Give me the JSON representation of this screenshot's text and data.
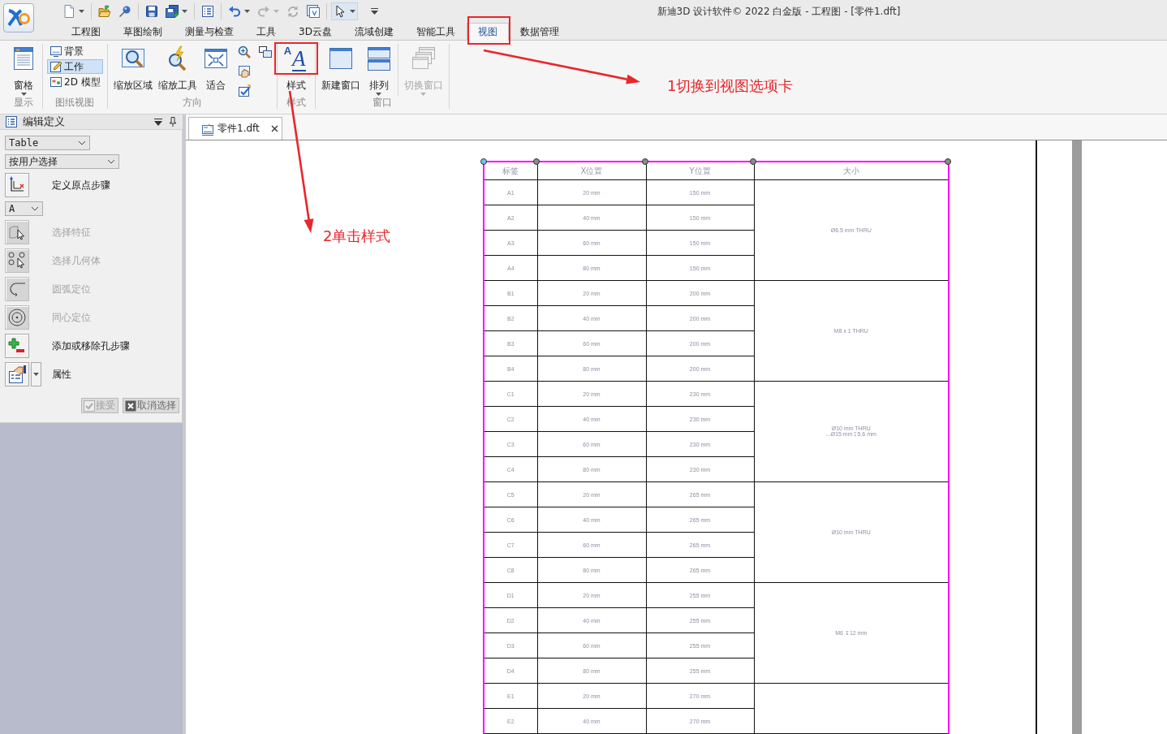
{
  "app": {
    "title": "新迪3D 设计软件© 2022 白金版 - 工程图 - [零件1.dft]"
  },
  "quick_access": [
    {
      "kind": "button",
      "dropdown": true,
      "disabled": false,
      "selected": false
    },
    {
      "kind": "separator"
    },
    {
      "kind": "button",
      "dropdown": false,
      "disabled": false,
      "selected": false
    },
    {
      "kind": "button",
      "dropdown": false,
      "disabled": false,
      "selected": false
    },
    {
      "kind": "separator"
    },
    {
      "kind": "button",
      "dropdown": false,
      "disabled": false,
      "selected": false
    },
    {
      "kind": "button",
      "dropdown": true,
      "disabled": false,
      "selected": false
    },
    {
      "kind": "separator"
    },
    {
      "kind": "button",
      "dropdown": false,
      "disabled": false,
      "selected": false
    },
    {
      "kind": "separator"
    },
    {
      "kind": "button",
      "dropdown": true,
      "disabled": false,
      "selected": false
    },
    {
      "kind": "button",
      "dropdown": true,
      "disabled": true,
      "selected": false
    },
    {
      "kind": "button",
      "dropdown": false,
      "disabled": true,
      "selected": false
    },
    {
      "kind": "button",
      "dropdown": false,
      "disabled": false,
      "selected": false
    },
    {
      "kind": "separator"
    },
    {
      "kind": "button",
      "dropdown": true,
      "disabled": false,
      "selected": true
    },
    {
      "kind": "menu"
    }
  ],
  "tabs": [
    {
      "label": "工程图",
      "selected": false,
      "highlighted": false
    },
    {
      "label": "草图绘制",
      "selected": false,
      "highlighted": false
    },
    {
      "label": "测量与检查",
      "selected": false,
      "highlighted": false
    },
    {
      "label": "工具",
      "selected": false,
      "highlighted": false
    },
    {
      "label": "3D云盘",
      "selected": false,
      "highlighted": false
    },
    {
      "label": "流域创建",
      "selected": false,
      "highlighted": false
    },
    {
      "label": "智能工具",
      "selected": false,
      "highlighted": false
    },
    {
      "label": "视图",
      "selected": true,
      "highlighted": true
    },
    {
      "label": "数据管理",
      "selected": false,
      "highlighted": false
    }
  ],
  "ribbon": {
    "groups": [
      {
        "label": "显示",
        "items": [
          {
            "kind": "large",
            "label": "窗格",
            "dropdown": true,
            "disabled": false,
            "highlighted": false
          }
        ]
      },
      {
        "label": "图纸视图",
        "items": [
          {
            "kind": "small",
            "label": "背景",
            "selected": false
          },
          {
            "kind": "small",
            "label": "工作",
            "selected": true
          },
          {
            "kind": "small",
            "label": "2D 模型",
            "selected": false
          }
        ]
      },
      {
        "label": "方向",
        "items": [
          {
            "kind": "large",
            "label": "缩放区域",
            "dropdown": false,
            "disabled": false,
            "highlighted": false
          },
          {
            "kind": "large",
            "label": "缩放工具",
            "dropdown": false,
            "disabled": false,
            "highlighted": false
          },
          {
            "kind": "large",
            "label": "适合",
            "dropdown": false,
            "disabled": false,
            "highlighted": false
          },
          {
            "kind": "icon"
          },
          {
            "kind": "icon"
          },
          {
            "kind": "icon"
          },
          {
            "kind": "icon"
          }
        ]
      },
      {
        "label": "样式",
        "items": [
          {
            "kind": "large",
            "label": "样式",
            "icon_glyphs": [
              "A",
              "A"
            ],
            "dropdown": false,
            "disabled": false,
            "highlighted": true
          }
        ]
      },
      {
        "label": "窗口",
        "items": [
          {
            "kind": "large",
            "label": "新建窗口",
            "dropdown": false,
            "disabled": false,
            "highlighted": false
          },
          {
            "kind": "large",
            "label": "排列",
            "dropdown": true,
            "disabled": false,
            "highlighted": false
          },
          {
            "kind": "separator"
          },
          {
            "kind": "large",
            "label": "切换窗口",
            "dropdown": true,
            "disabled": true,
            "highlighted": false
          }
        ]
      }
    ]
  },
  "panel": {
    "title": "编辑定义",
    "controls": [
      {
        "kind": "select",
        "value": "Table"
      },
      {
        "kind": "select",
        "value": "按用户选择"
      },
      {
        "kind": "step",
        "label": "定义原点步骤",
        "disabled": false
      },
      {
        "kind": "select",
        "value": "A"
      },
      {
        "kind": "step",
        "label": "选择特征",
        "disabled": true
      },
      {
        "kind": "step",
        "label": "选择几何体",
        "disabled": true
      },
      {
        "kind": "step",
        "label": "圆弧定位",
        "disabled": true
      },
      {
        "kind": "step",
        "label": "同心定位",
        "disabled": true
      },
      {
        "kind": "step",
        "label": "添加或移除孔步骤",
        "disabled": false
      },
      {
        "kind": "step",
        "label": "属性",
        "disabled": false,
        "dropdown": true
      }
    ],
    "actions": [
      {
        "label": "接受",
        "disabled": true
      },
      {
        "label": "取消选择",
        "disabled": false
      }
    ]
  },
  "document": {
    "tabs": [
      {
        "label": "零件1.dft",
        "selected": true
      }
    ],
    "table": {
      "handles": [
        {
          "selected": true
        },
        {
          "selected": false
        },
        {
          "selected": false
        },
        {
          "selected": false
        },
        {
          "selected": false
        }
      ],
      "columns": [
        "标签",
        "X位置",
        "Y位置",
        "大小"
      ],
      "groups": [
        {
          "size": [
            "Ø6.5 mm THRU"
          ],
          "rows": [
            {
              "label": "A1",
              "x": "20 mm",
              "y": "150 mm"
            },
            {
              "label": "A2",
              "x": "40 mm",
              "y": "150 mm"
            },
            {
              "label": "A3",
              "x": "60 mm",
              "y": "150 mm"
            },
            {
              "label": "A4",
              "x": "80 mm",
              "y": "150 mm"
            }
          ]
        },
        {
          "size": [
            "M8 x 1 THRU"
          ],
          "rows": [
            {
              "label": "B1",
              "x": "20 mm",
              "y": "200 mm"
            },
            {
              "label": "B2",
              "x": "40 mm",
              "y": "200 mm"
            },
            {
              "label": "B3",
              "x": "60 mm",
              "y": "200 mm"
            },
            {
              "label": "B4",
              "x": "80 mm",
              "y": "200 mm"
            }
          ]
        },
        {
          "size": [
            "Ø10 mm THRU",
            "⌴Ø15 mm ↧5.6 mm"
          ],
          "rows": [
            {
              "label": "C1",
              "x": "20 mm",
              "y": "230 mm"
            },
            {
              "label": "C2",
              "x": "40 mm",
              "y": "230 mm"
            },
            {
              "label": "C3",
              "x": "60 mm",
              "y": "230 mm"
            },
            {
              "label": "C4",
              "x": "80 mm",
              "y": "230 mm"
            }
          ]
        },
        {
          "size": [
            "Ø10 mm THRU"
          ],
          "rows": [
            {
              "label": "C5",
              "x": "20 mm",
              "y": "265 mm"
            },
            {
              "label": "C6",
              "x": "40 mm",
              "y": "265 mm"
            },
            {
              "label": "C7",
              "x": "60 mm",
              "y": "265 mm"
            },
            {
              "label": "C8",
              "x": "80 mm",
              "y": "265 mm"
            }
          ]
        },
        {
          "size": [
            "M6 ↧12 mm"
          ],
          "rows": [
            {
              "label": "D1",
              "x": "20 mm",
              "y": "255 mm"
            },
            {
              "label": "D2",
              "x": "40 mm",
              "y": "255 mm"
            },
            {
              "label": "D3",
              "x": "60 mm",
              "y": "255 mm"
            },
            {
              "label": "D4",
              "x": "80 mm",
              "y": "255 mm"
            }
          ]
        },
        {
          "rows": [
            {
              "label": "E1",
              "x": "20 mm",
              "y": "270 mm"
            },
            {
              "label": "E2",
              "x": "40 mm",
              "y": "270 mm"
            }
          ]
        }
      ]
    }
  },
  "annotations": [
    {
      "kind": "callout",
      "text": "1切换到视图选项卡"
    },
    {
      "kind": "callout",
      "text": "2单击样式"
    }
  ]
}
